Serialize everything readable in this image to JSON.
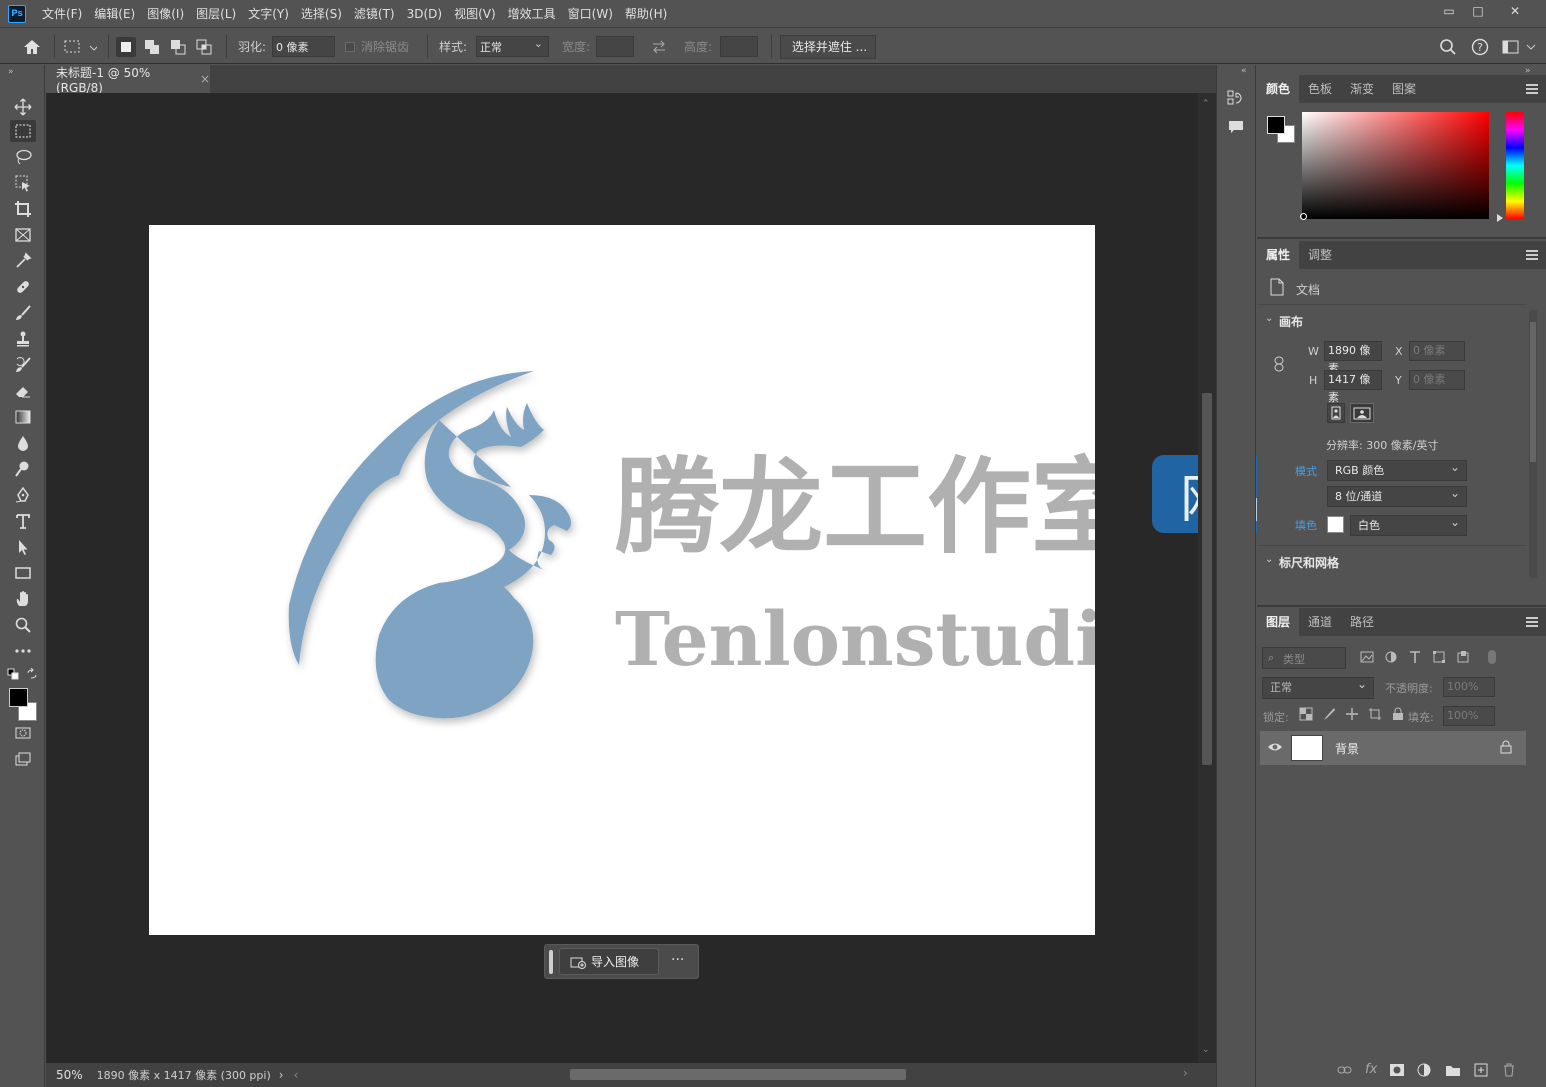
{
  "app": {
    "logo_text": "Ps"
  },
  "menu": [
    "文件(F)",
    "编辑(E)",
    "图像(I)",
    "图层(L)",
    "文字(Y)",
    "选择(S)",
    "滤镜(T)",
    "3D(D)",
    "视图(V)",
    "增效工具",
    "窗口(W)",
    "帮助(H)"
  ],
  "window_controls": {
    "minimize": "▭",
    "restore": "□",
    "close": "✕"
  },
  "options": {
    "feather_label": "羽化:",
    "feather_value": "0 像素",
    "antialias_label": "消除锯齿",
    "style_label": "样式:",
    "style_value": "正常",
    "width_label": "宽度:",
    "height_label": "高度:",
    "select_mask_label": "选择并遮住 ..."
  },
  "document": {
    "tab_title": "未标题-1 @ 50%(RGB/8)",
    "tab_close": "×",
    "watermark_cn": "腾龙工作室",
    "watermark_badge": "网站",
    "watermark_en": "Tenlonstudio.com"
  },
  "context_bar": {
    "import_label": "导入图像",
    "more": "···"
  },
  "status": {
    "zoom": "50%",
    "info": "1890 像素 x 1417 像素 (300 ppi)",
    "arrow": "›"
  },
  "color_panel": {
    "tabs": [
      "颜色",
      "色板",
      "渐变",
      "图案"
    ],
    "foreground": "#000000",
    "background": "#ffffff"
  },
  "properties_panel": {
    "tabs": [
      "属性",
      "调整"
    ],
    "doc_label": "文档",
    "canvas_section": "画布",
    "w_label": "W",
    "w_value": "1890 像素",
    "h_label": "H",
    "h_value": "1417 像素",
    "x_label": "X",
    "x_value": "0 像素",
    "y_label": "Y",
    "y_value": "0 像素",
    "resolution": "分辨率: 300 像素/英寸",
    "mode_label": "模式",
    "mode_value": "RGB 颜色",
    "depth_value": "8 位/通道",
    "fill_label": "填色",
    "fill_value": "白色",
    "rulers_section": "标尺和网格"
  },
  "layers_panel": {
    "tabs": [
      "图层",
      "通道",
      "路径"
    ],
    "filter_placeholder": "类型",
    "blend_value": "正常",
    "opacity_label": "不透明度:",
    "opacity_value": "100%",
    "lock_label": "锁定:",
    "fill_label": "填充:",
    "fill_value": "100%",
    "layers": [
      {
        "name": "背景",
        "visible": true,
        "locked": true
      }
    ]
  },
  "colors": {
    "accent": "#31a8ff",
    "link_blue": "#4a9fe0",
    "dragon": "#7fa3c2"
  }
}
